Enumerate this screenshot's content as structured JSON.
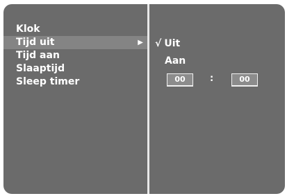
{
  "menu": {
    "items": [
      {
        "label": "Klok"
      },
      {
        "label": "Tijd uit",
        "arrow": "▶"
      },
      {
        "label": "Tijd aan"
      },
      {
        "label": "Slaaptijd"
      },
      {
        "label": "Sleep timer"
      }
    ],
    "selected": "Tijd uit"
  },
  "submenu": {
    "check_mark": "√",
    "option_uit": "Uit",
    "option_aan": "Aan",
    "hour": "00",
    "separator": ":",
    "minute": "00"
  },
  "colors": {
    "background": "#6b6b6b",
    "highlight": "#848484",
    "text": "#ffffff",
    "divider": "#e8e8e8"
  }
}
